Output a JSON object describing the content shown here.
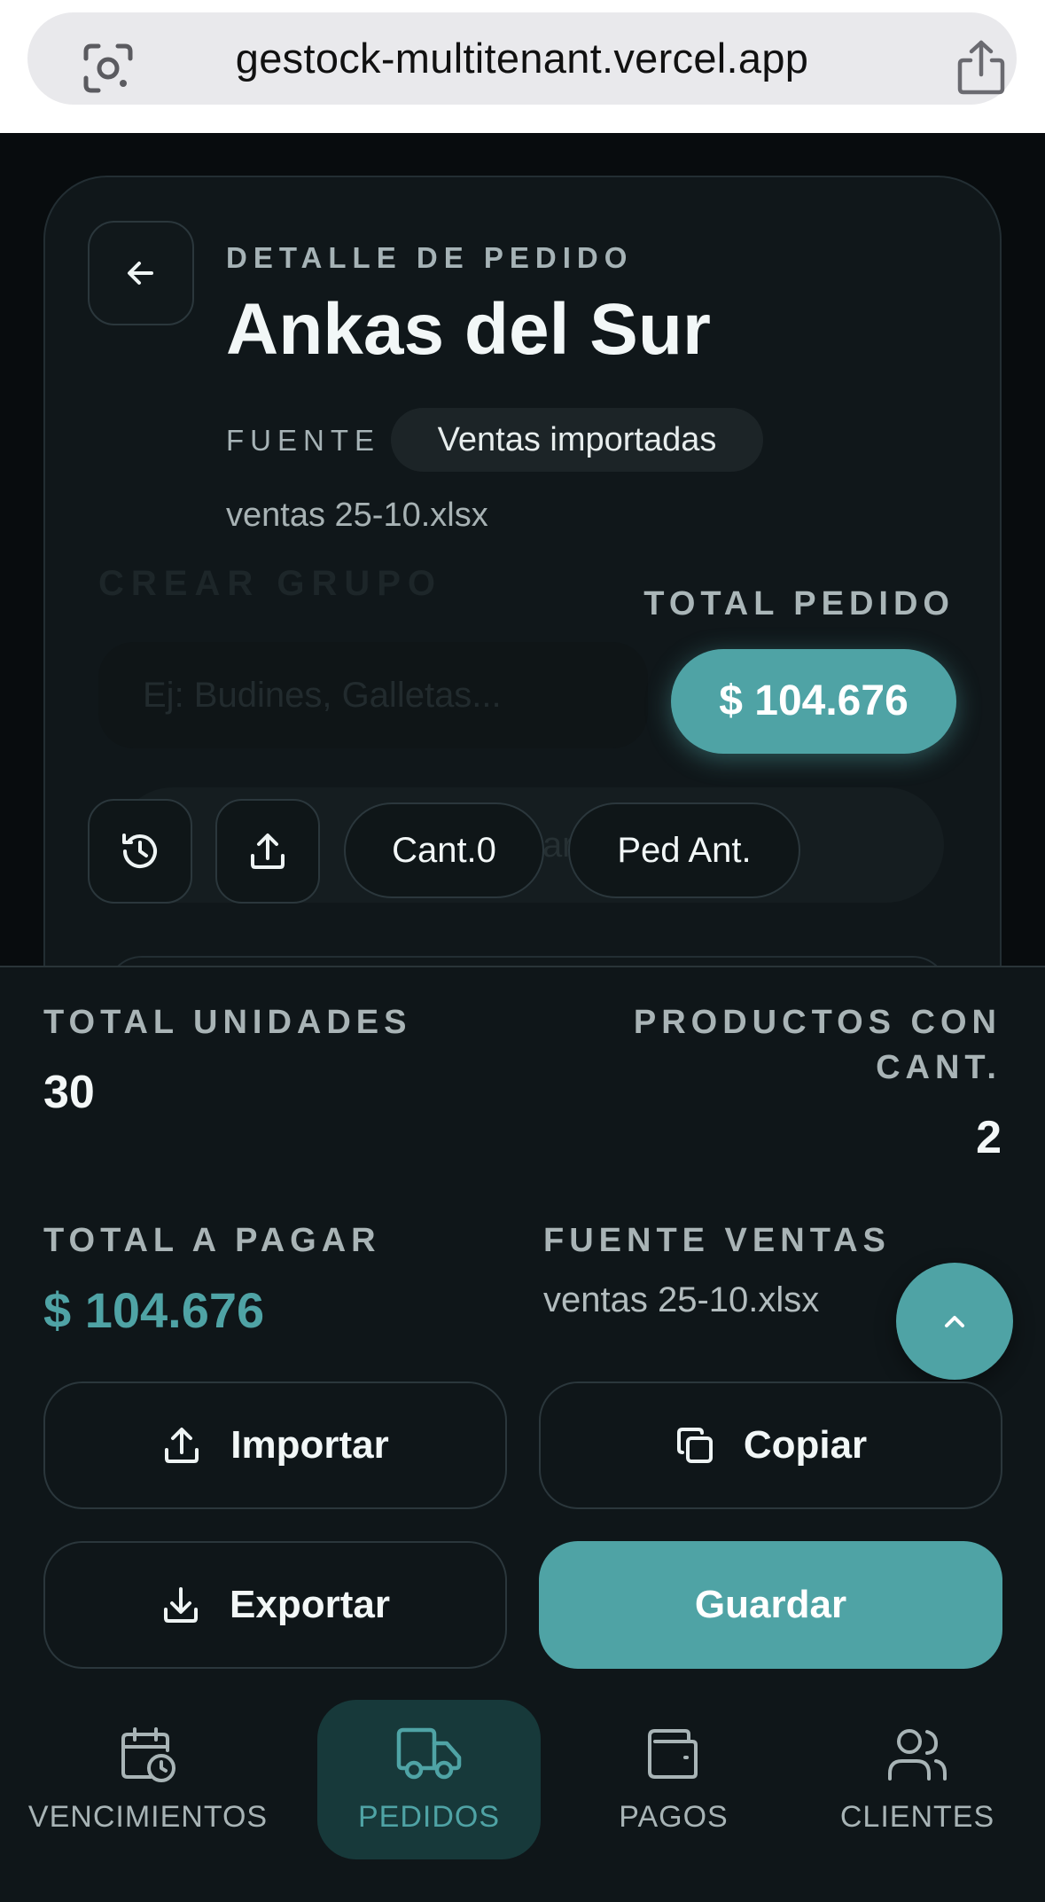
{
  "browser": {
    "url": "gestock-multitenant.vercel.app"
  },
  "header": {
    "eyebrow": "DETALLE DE PEDIDO",
    "title": "Ankas del Sur",
    "source_label": "FUENTE",
    "source_chip": "Ventas importadas",
    "file_name": "ventas 25-10.xlsx"
  },
  "background_form": {
    "group_label": "CREAR GRUPO",
    "group_placeholder": "Ej: Budines, Galletas...",
    "create_button": "Crear"
  },
  "order_total": {
    "label": "TOTAL PEDIDO",
    "value": "$ 104.676"
  },
  "toolbar": {
    "quantity_button": "Cant.0",
    "previous_order_button": "Ped Ant."
  },
  "summary": {
    "units_label": "TOTAL UNIDADES",
    "units_value": "30",
    "products_label_line1": "PRODUCTOS CON",
    "products_label_line2": "CANT.",
    "products_value": "2",
    "pay_label": "TOTAL A PAGAR",
    "pay_value": "$ 104.676",
    "sales_source_label": "FUENTE VENTAS",
    "sales_source_file": "ventas 25-10.xlsx"
  },
  "actions": {
    "import": "Importar",
    "copy": "Copiar",
    "export": "Exportar",
    "save": "Guardar"
  },
  "nav": {
    "items": [
      {
        "label": "VENCIMIENTOS",
        "icon": "calendar-clock-icon"
      },
      {
        "label": "PEDIDOS",
        "icon": "truck-icon",
        "active": true
      },
      {
        "label": "PAGOS",
        "icon": "wallet-icon"
      },
      {
        "label": "CLIENTES",
        "icon": "users-icon"
      }
    ]
  },
  "colors": {
    "accent": "#4fa3a5",
    "background": "#0f1619"
  }
}
